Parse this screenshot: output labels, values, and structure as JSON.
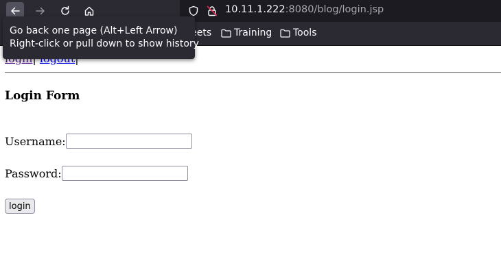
{
  "browser": {
    "url_host": "10.11.1.222",
    "url_rest": ":8080/blog/login.jsp",
    "bookmarks": [
      {
        "label": "heat sheets"
      },
      {
        "label": "Training"
      },
      {
        "label": "Tools"
      }
    ],
    "tooltip": {
      "line1": "Go back one page (Alt+Left Arrow)",
      "line2": "Right-click or pull down to show history"
    }
  },
  "page": {
    "nav": {
      "login_label": "login",
      "separator": "|",
      "logout_label": "logout"
    },
    "heading": "Login Form",
    "username_label": "Username:",
    "username_value": "",
    "password_label": "Password:",
    "password_value": "",
    "submit_label": "login"
  }
}
